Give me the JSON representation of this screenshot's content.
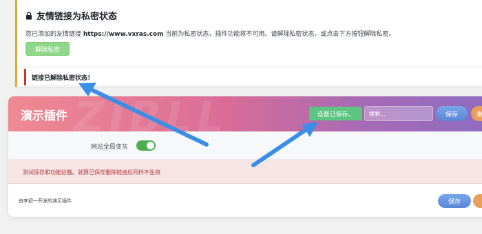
{
  "notice": {
    "title": "友情链接为私密状态",
    "text_prefix": "您已添加的友情链接 ",
    "link_url": "https://www.vxras.com",
    "text_suffix": " 当前为私密状态，插件功能将不可用。请解除私密状态，或点击下方按钮解除私密。",
    "unlock_button": "解除私密",
    "success_message": "链接已解除私密状态！"
  },
  "plugin_panel": {
    "title": "演示插件",
    "watermark": "ZIBLL",
    "saved_badge": "设置已保存。",
    "search_placeholder": "搜索...",
    "save_button": "保存",
    "reset_button": "重",
    "settings": [
      {
        "label": "网站全局变灰",
        "enabled": true
      }
    ],
    "warning": "测试保存和功能拦截。就算已保存删除链接后同样不生效",
    "footer_text": "由李初一开发的演示插件",
    "footer_save_button": "保存"
  },
  "colors": {
    "notice_border": "#e8a830",
    "success_border": "#c0392b",
    "saved_badge": "#5cc580",
    "toggle_on": "#4cae4c",
    "save_button": "#5a86d6",
    "reset_button": "#e9a05a",
    "arrow": "#3a8ee6"
  }
}
